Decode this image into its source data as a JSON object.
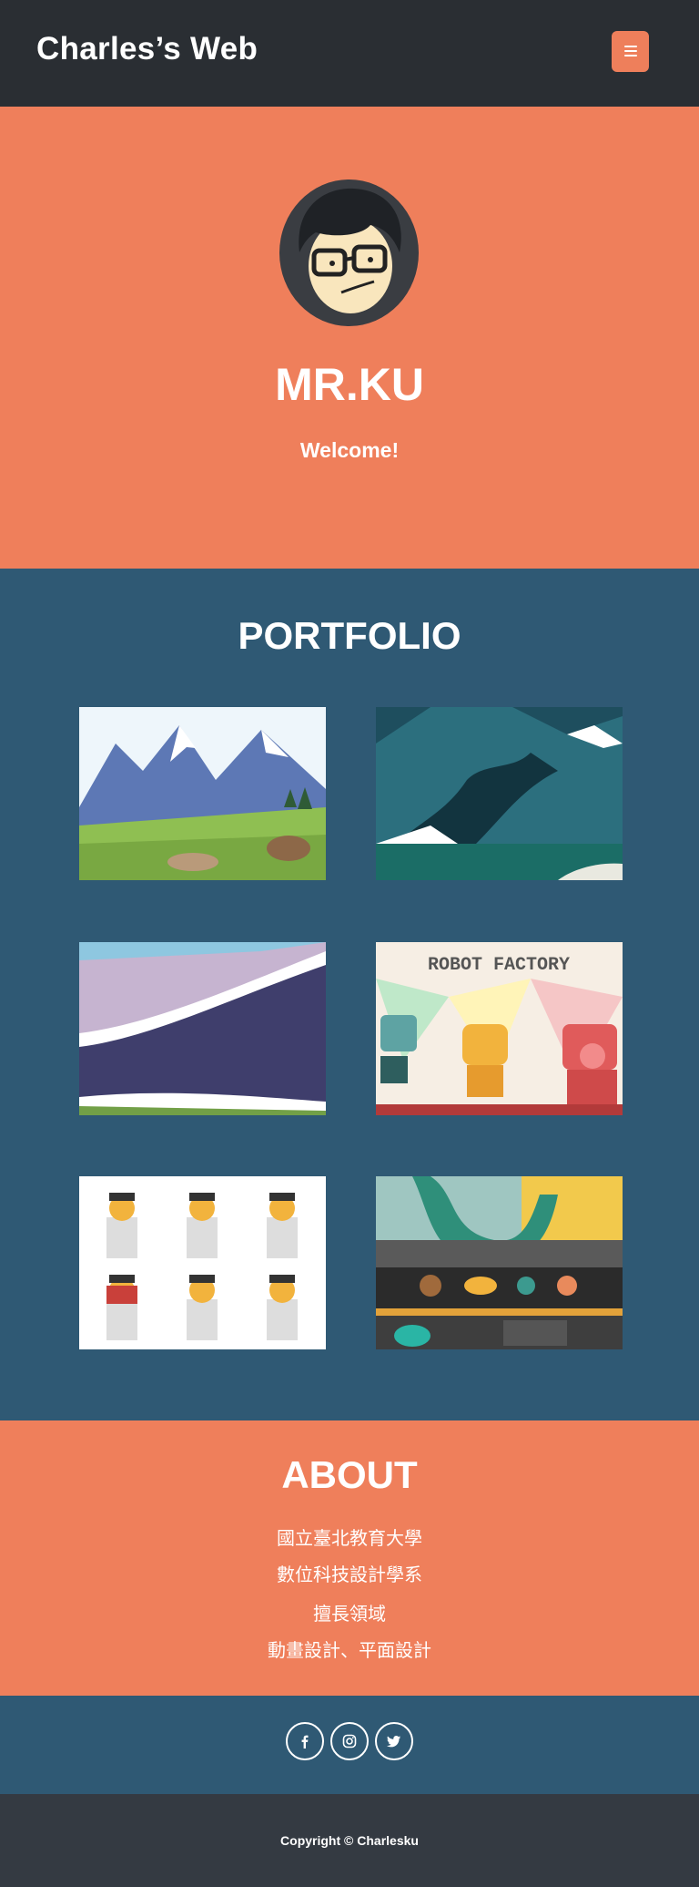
{
  "navbar": {
    "brand": "Charles’s Web",
    "menu_icon": "hamburger-icon",
    "menu_color": "#ee7f5b"
  },
  "hero": {
    "title": "MR.KU",
    "subtitle": "Welcome!",
    "avatar_icon": "avatar-illustration",
    "background": "#ef7f5b"
  },
  "portfolio": {
    "title": "PORTFOLIO",
    "background": "#2f5974",
    "items": [
      {
        "label": "mountain-meadow-illustration"
      },
      {
        "label": "dark-mountain-illustration"
      },
      {
        "label": "purple-hills-illustration"
      },
      {
        "label": "robot-factory-illustration",
        "text": "ROBOT FACTORY"
      },
      {
        "label": "cup-characters-illustration"
      },
      {
        "label": "toy-factory-illustration"
      }
    ]
  },
  "about": {
    "title": "ABOUT",
    "lines": [
      "國立臺北教育大學",
      "數位科技設計學系",
      "擅長領域",
      "動畫設計、平面設計"
    ]
  },
  "social": {
    "icons": [
      "facebook-icon",
      "instagram-icon",
      "twitter-icon"
    ]
  },
  "footer": {
    "copyright": "Copyright © Charlesku"
  }
}
